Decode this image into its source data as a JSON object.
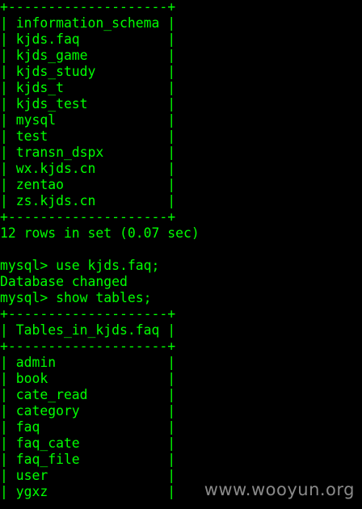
{
  "terminal": {
    "foreground_color": "#00ff00",
    "background_color": "#000000",
    "lines": [
      "+--------------------+",
      "| information_schema |",
      "| kjds.faq           |",
      "| kjds_game          |",
      "| kjds_study         |",
      "| kjds_t             |",
      "| kjds_test          |",
      "| mysql              |",
      "| test               |",
      "| transn_dspx        |",
      "| wx.kjds.cn         |",
      "| zentao             |",
      "| zs.kjds.cn         |",
      "+--------------------+",
      "12 rows in set (0.07 sec)",
      "",
      "mysql> use kjds.faq;",
      "Database changed",
      "mysql> show tables;",
      "+--------------------+",
      "| Tables_in_kjds.faq |",
      "+--------------------+",
      "| admin              |",
      "| book               |",
      "| cate_read          |",
      "| category           |",
      "| faq                |",
      "| faq_cate           |",
      "| faq_file           |",
      "| user               |",
      "| ygxz               |"
    ]
  },
  "watermark": {
    "text": "www.wooyun.org",
    "color": "#8a8a8a"
  }
}
